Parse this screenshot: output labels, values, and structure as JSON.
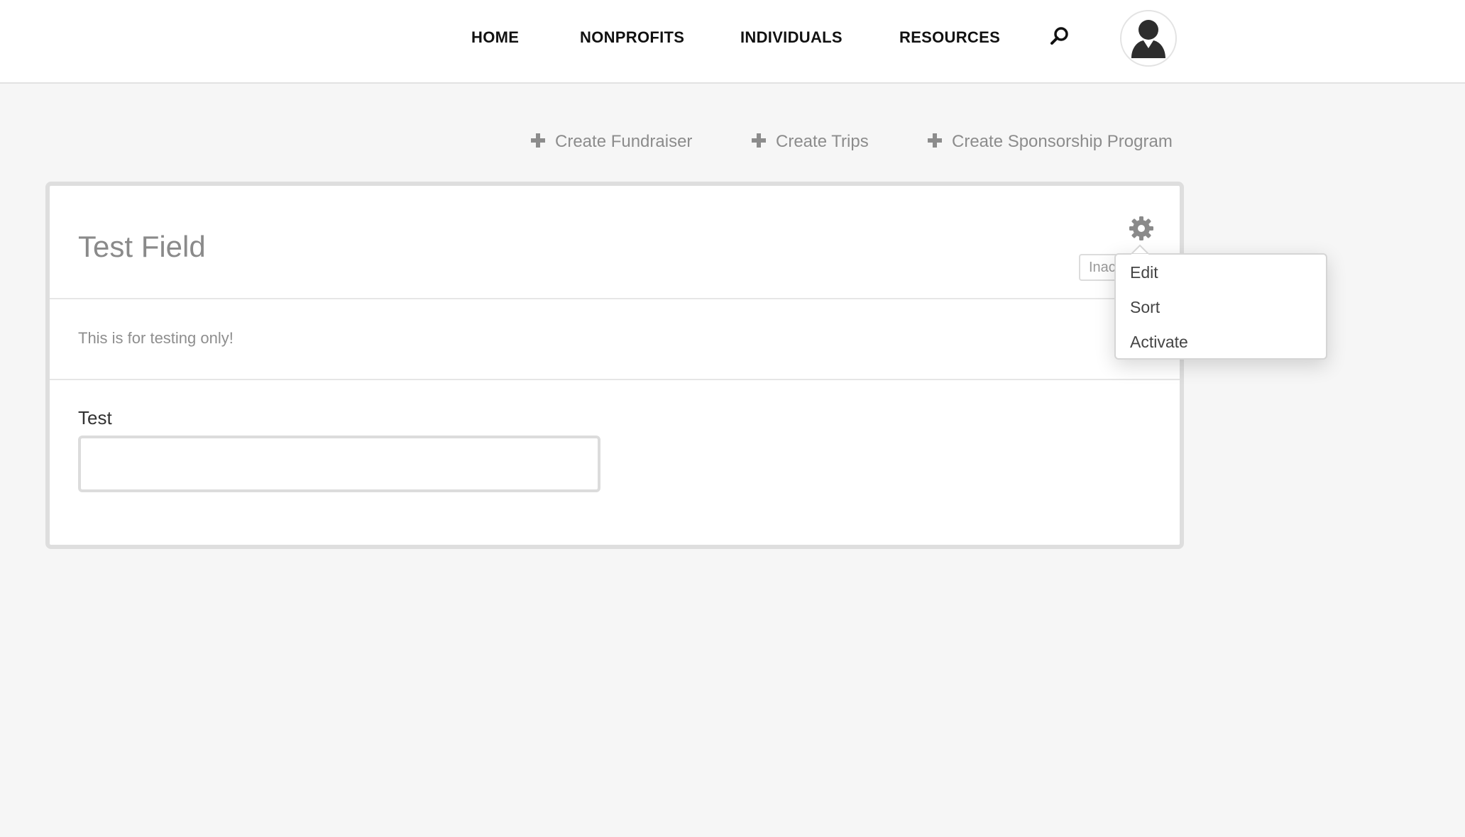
{
  "nav": {
    "items": [
      {
        "label": "HOME"
      },
      {
        "label": "NONPROFITS"
      },
      {
        "label": "INDIVIDUALS"
      },
      {
        "label": "RESOURCES"
      }
    ],
    "search_icon": "search-icon",
    "avatar_icon": "user-avatar-icon"
  },
  "actions": [
    {
      "label": "Create Fundraiser",
      "icon": "plus-icon"
    },
    {
      "label": "Create Trips",
      "icon": "plus-icon"
    },
    {
      "label": "Create Sponsorship Program",
      "icon": "plus-icon"
    }
  ],
  "card": {
    "title": "Test Field",
    "description": "This is for testing only!",
    "status": "Inactive",
    "settings_icon": "gear-icon",
    "field": {
      "label": "Test",
      "value": "",
      "placeholder": ""
    }
  },
  "settings_menu": {
    "items": [
      {
        "label": "Edit"
      },
      {
        "label": "Sort"
      },
      {
        "label": "Activate"
      }
    ]
  },
  "colors": {
    "page_background": "#f6f6f6",
    "header_background": "#ffffff",
    "muted_text": "#8c8c8c",
    "border": "#dedede"
  }
}
